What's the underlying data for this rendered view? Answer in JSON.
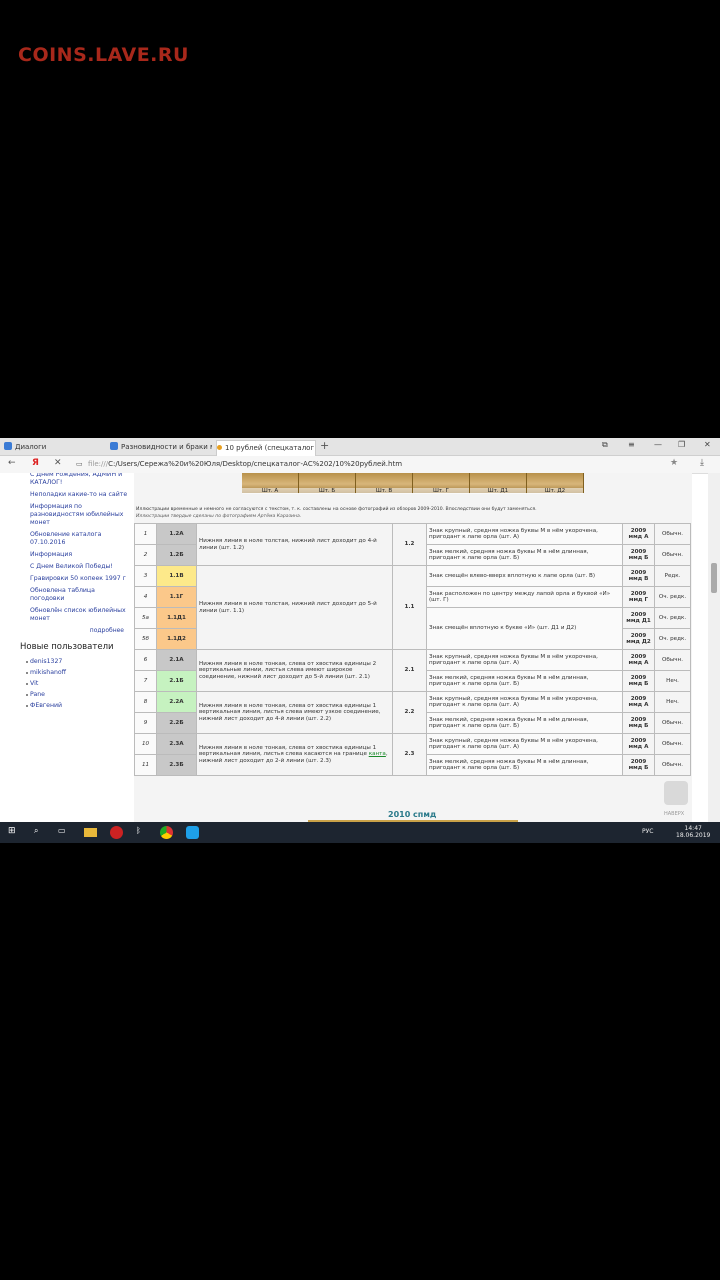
{
  "site_logo": "COINS.LAVE.RU",
  "browser": {
    "tabs": [
      {
        "label": "Диалоги",
        "color": "#3a7bd5"
      },
      {
        "label": "Разновидности и браки м",
        "color": "#3a7bd5"
      },
      {
        "label": "10 рублей (спецкаталог",
        "color": "#e8a020"
      }
    ],
    "url_scheme": "file:///",
    "url_path": "C:/Users/Сережа%20и%20Юля/Desktop/спецкаталог-АС%202/10%20рублей.htm",
    "back": "←",
    "yandex": "Я",
    "close": "✕",
    "bookmark": "★",
    "download": "⤓",
    "win_icons": [
      "⧉",
      "≡",
      "—",
      "❐",
      "✕"
    ]
  },
  "sidebar": {
    "links": [
      "С Днем Рождения, АДМИН и КАТАЛОГ!",
      "Неполадки какие-то на сайте",
      "Информация по разновидностям юбилейных монет",
      "Обновление каталога 07.10.2016",
      "Информация",
      "С Днем Великой Победы!",
      "Гравировки 50 копеек 1997 г",
      "Обновлена таблица погодовки",
      "Обновлён список юбилейных монет"
    ],
    "more": "подробнее",
    "new_users_title": "Новые пользователи",
    "users": [
      "denis1327",
      "mikishanoff",
      "Vit",
      "Pane",
      "ФЕвгений"
    ]
  },
  "content": {
    "coin_labels": [
      "Шт. А",
      "Шт. Б",
      "Шт. В",
      "Шт. Г",
      "Шт. Д1",
      "Шт. Д2"
    ],
    "note": "Иллюстрации временные и немного не согласуются с текстом, т. к. составлены на основе фотографий из обзоров 2009-2010. Впоследствии они будут заменяться.",
    "note2": "Иллюстрации твердые сделаны по фотографиям Артёма Каразина.",
    "section_title": "2010 спмд",
    "up_label": "НАВЕРХ"
  },
  "table": {
    "rows": [
      {
        "n": "1",
        "code": "1.2А",
        "code_bg": "#c8c8c8",
        "feature": "Знак крупный, средняя ножка буквы М в нём укорочена, пригодант к лапе орла (шт. А)",
        "year": "2009",
        "mint": "ммд А",
        "rarity": "Обычн."
      },
      {
        "n": "2",
        "code": "1.2Б",
        "code_bg": "#c8c8c8",
        "feature": "Знак мелкий, средняя ножка буквы М в нём длинная, пригодант к лапе орла (шт. Б)",
        "year": "2009",
        "mint": "ммд Б",
        "rarity": "Обычн."
      },
      {
        "n": "3",
        "code": "1.1В",
        "code_bg": "#fde98a",
        "feature": "Знак смещён влево-вверх вплотную к лапе орла (шт. В)",
        "year": "2009",
        "mint": "ммд В",
        "rarity": "Редк."
      },
      {
        "n": "4",
        "code": "1.1Г",
        "code_bg": "#fbc88a",
        "feature": "Знак расположен по центру между лапой орла и буквой «И» (шт. Г)",
        "year": "2009",
        "mint": "ммд Г",
        "rarity": "Оч. редк."
      },
      {
        "n": "5а",
        "code": "1.1Д1",
        "code_bg": "#fbc88a",
        "feature": "Знак смещён вплотную к букве «И» (шт. Д1 и Д2)",
        "year": "2009",
        "mint": "ммд Д1",
        "rarity": "Оч. редк."
      },
      {
        "n": "5б",
        "code": "1.1Д2",
        "code_bg": "#fbc88a",
        "feature": "",
        "year": "2009",
        "mint": "ммд Д2",
        "rarity": "Оч. редк."
      },
      {
        "n": "6",
        "code": "2.1А",
        "code_bg": "#c8c8c8",
        "feature": "Знак крупный, средняя ножка буквы М в нём укорочена, пригодант к лапе орла (шт. А)",
        "year": "2009",
        "mint": "ммд А",
        "rarity": "Обычн."
      },
      {
        "n": "7",
        "code": "2.1Б",
        "code_bg": "#c6f2c0",
        "feature": "Знак мелкий, средняя ножка буквы М в нём длинная, пригодант к лапе орла (шт. Б)",
        "year": "2009",
        "mint": "ммд Б",
        "rarity": "Неч."
      },
      {
        "n": "8",
        "code": "2.2А",
        "code_bg": "#c6f2c0",
        "feature": "Знак крупный, средняя ножка буквы М в нём укорочена, пригодант к лапе орла (шт. А)",
        "year": "2009",
        "mint": "ммд А",
        "rarity": "Неч."
      },
      {
        "n": "9",
        "code": "2.2Б",
        "code_bg": "#c8c8c8",
        "feature": "Знак мелкий, средняя ножка буквы М в нём длинная, пригодант к лапе орла (шт. Б)",
        "year": "2009",
        "mint": "ммд Б",
        "rarity": "Обычн."
      },
      {
        "n": "10",
        "code": "2.3А",
        "code_bg": "#c8c8c8",
        "feature": "Знак крупный, средняя ножка буквы М в нём укорочена, пригодант к лапе орла (шт. А)",
        "year": "2009",
        "mint": "ммд А",
        "rarity": "Обычн."
      },
      {
        "n": "11",
        "code": "2.3Б",
        "code_bg": "#c8c8c8",
        "feature": "Знак мелкий, средняя ножка буквы М в нём длинная, пригодант к лапе орла (шт. Б)",
        "year": "2009",
        "mint": "ммд Б",
        "rarity": "Обычн."
      }
    ],
    "groups": [
      {
        "desc": "Нижняя линия в ноле толстая, нижний лист доходит до 4-й линии (шт. 1.2)",
        "code": "1.2"
      },
      {
        "desc": "Нижняя линия в ноле толстая, нижний лист доходит до 5-й линии (шт. 1.1)",
        "code": "1.1"
      },
      {
        "desc": "Нижняя линия в ноле тонкая, слева от хвостика единицы 2 вертикальные линии, листья слева имеют широкое соединение, нижний лист доходит до 5-й линии (шт. 2.1)",
        "code": "2.1"
      },
      {
        "desc": "Нижняя линия в ноле тонкая, слева от хвостика единицы 1 вертикальная линия, листья слева имеют узкое соединение, нижний лист доходит до 4-й линии (шт. 2.2)",
        "code": "2.2"
      },
      {
        "desc_before": "Нижняя линия в ноле тонкая, слева от хвостика единицы 1 вертикальная линия, листья слева касаются на границе ",
        "desc_hl": "канта",
        "desc_after": ", нижний лист доходит до 2-й линии (шт. 2.3)",
        "code": "2.3"
      }
    ]
  },
  "taskbar": {
    "lang": "РУС",
    "time": "14:47",
    "date": "18.06.2019"
  }
}
